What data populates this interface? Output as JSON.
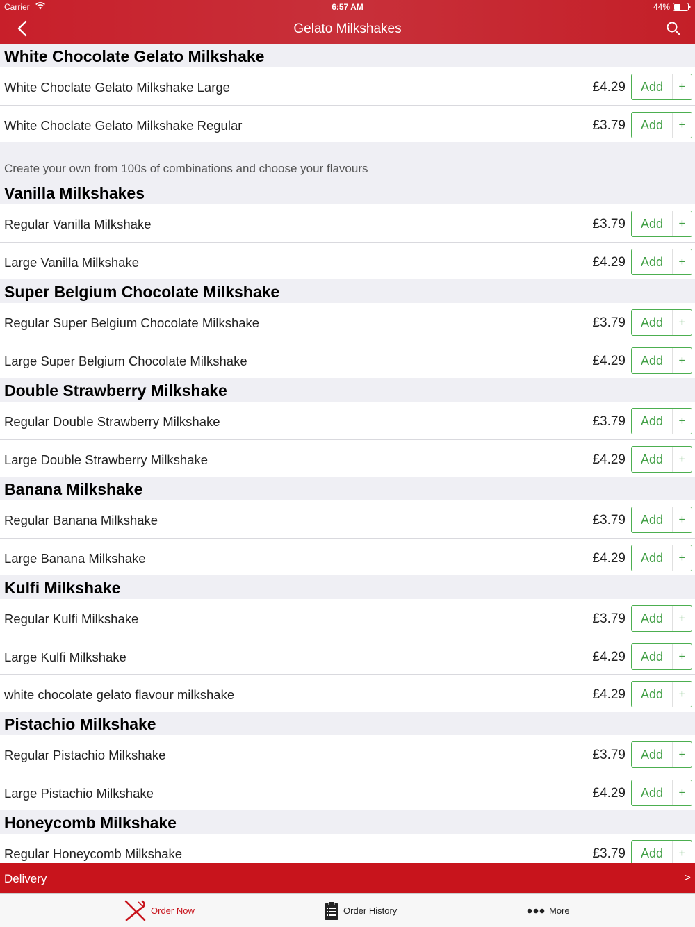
{
  "status": {
    "carrier": "Carrier",
    "time": "6:57 AM",
    "battery": "44%"
  },
  "header": {
    "title": "Gelato Milkshakes"
  },
  "sections": [
    {
      "title": "White Chocolate Gelato Milkshake",
      "desc": "",
      "items": [
        {
          "name": "White Choclate Gelato Milkshake Large",
          "price": "£4.29"
        },
        {
          "name": "White Choclate Gelato Milkshake Regular",
          "price": "£3.79"
        }
      ]
    },
    {
      "title": "Vanilla Milkshakes",
      "desc": "Create your own from 100s of combinations and choose your flavours",
      "items": [
        {
          "name": "Regular Vanilla Milkshake",
          "price": "£3.79"
        },
        {
          "name": "Large Vanilla Milkshake",
          "price": "£4.29"
        }
      ]
    },
    {
      "title": "Super Belgium Chocolate Milkshake",
      "desc": "",
      "items": [
        {
          "name": "Regular Super Belgium Chocolate Milkshake",
          "price": "£3.79"
        },
        {
          "name": "Large Super Belgium Chocolate Milkshake",
          "price": "£4.29"
        }
      ]
    },
    {
      "title": "Double Strawberry Milkshake",
      "desc": "",
      "items": [
        {
          "name": "Regular Double Strawberry Milkshake",
          "price": "£3.79"
        },
        {
          "name": "Large Double Strawberry Milkshake",
          "price": "£4.29"
        }
      ]
    },
    {
      "title": "Banana Milkshake",
      "desc": "",
      "items": [
        {
          "name": "Regular Banana Milkshake",
          "price": "£3.79"
        },
        {
          "name": "Large Banana Milkshake",
          "price": "£4.29"
        }
      ]
    },
    {
      "title": "Kulfi Milkshake",
      "desc": "",
      "items": [
        {
          "name": "Regular Kulfi Milkshake",
          "price": "£3.79"
        },
        {
          "name": "Large Kulfi Milkshake",
          "price": "£4.29"
        },
        {
          "name": "white chocolate gelato flavour milkshake",
          "price": "£4.29"
        }
      ]
    },
    {
      "title": "Pistachio Milkshake",
      "desc": "",
      "items": [
        {
          "name": "Regular Pistachio Milkshake",
          "price": "£3.79"
        },
        {
          "name": "Large Pistachio Milkshake",
          "price": "£4.29"
        }
      ]
    },
    {
      "title": "Honeycomb Milkshake",
      "desc": "",
      "items": [
        {
          "name": "Regular Honeycomb Milkshake",
          "price": "£3.79"
        }
      ]
    }
  ],
  "add_label": "Add",
  "add_plus": "+",
  "delivery": {
    "label": "Delivery",
    "arrow": ">"
  },
  "tabs": [
    {
      "label": "Order Now",
      "icon": "fork-knife-icon",
      "active": true
    },
    {
      "label": "Order History",
      "icon": "clipboard-icon",
      "active": false
    },
    {
      "label": "More",
      "icon": "more-dots-icon",
      "active": false
    }
  ],
  "colors": {
    "brand_red": "#c8141c",
    "add_green": "#43a047"
  }
}
